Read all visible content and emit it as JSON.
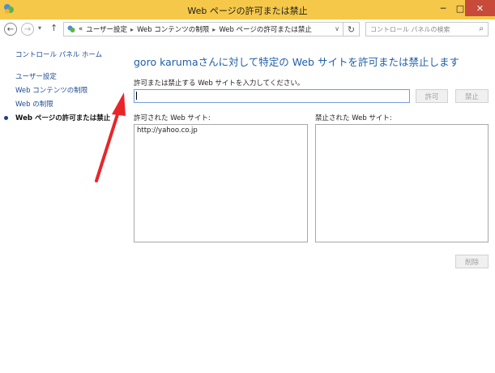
{
  "window": {
    "title": "Web ページの許可または禁止",
    "minimize": "─",
    "maximize": "□",
    "close": "✕"
  },
  "nav": {
    "back_icon": "arrow-left-icon",
    "forward_icon": "arrow-right-icon",
    "back_glyph": "←",
    "forward_glyph": "→",
    "recent_glyph": "▾",
    "up_glyph": "↑",
    "path_prefix": "«",
    "breadcrumb": [
      "ユーザー設定",
      "Web コンテンツの制限",
      "Web ページの許可または禁止"
    ],
    "dropdown_glyph": "∨",
    "refresh_glyph": "↻",
    "search_placeholder": "コントロール パネルの検索",
    "search_glyph": "⌕"
  },
  "sidebar": {
    "home": "コントロール パネル ホーム",
    "items": [
      {
        "label": "ユーザー設定",
        "active": false
      },
      {
        "label": "Web コンテンツの制限",
        "active": false
      },
      {
        "label": "Web の制限",
        "active": false
      },
      {
        "label": "Web ページの許可または禁止",
        "active": true
      }
    ]
  },
  "main": {
    "title": "goro karumaさんに対して特定の Web サイトを許可または禁止します",
    "instruction": "許可または禁止する Web サイトを入力してください。",
    "input_value": "",
    "allow_button": "許可",
    "block_button": "禁止",
    "allowed_label": "許可された Web サイト:",
    "blocked_label": "禁止された Web サイト:",
    "allowed_sites": [
      "http://yahoo.co.jp"
    ],
    "blocked_sites": [],
    "remove_button": "削除"
  },
  "colors": {
    "titlebar": "#f5c84a",
    "close_button": "#c74a3a",
    "link": "#1f4c8f",
    "heading": "#1f5fa8",
    "annotation_arrow": "#e8262a"
  }
}
